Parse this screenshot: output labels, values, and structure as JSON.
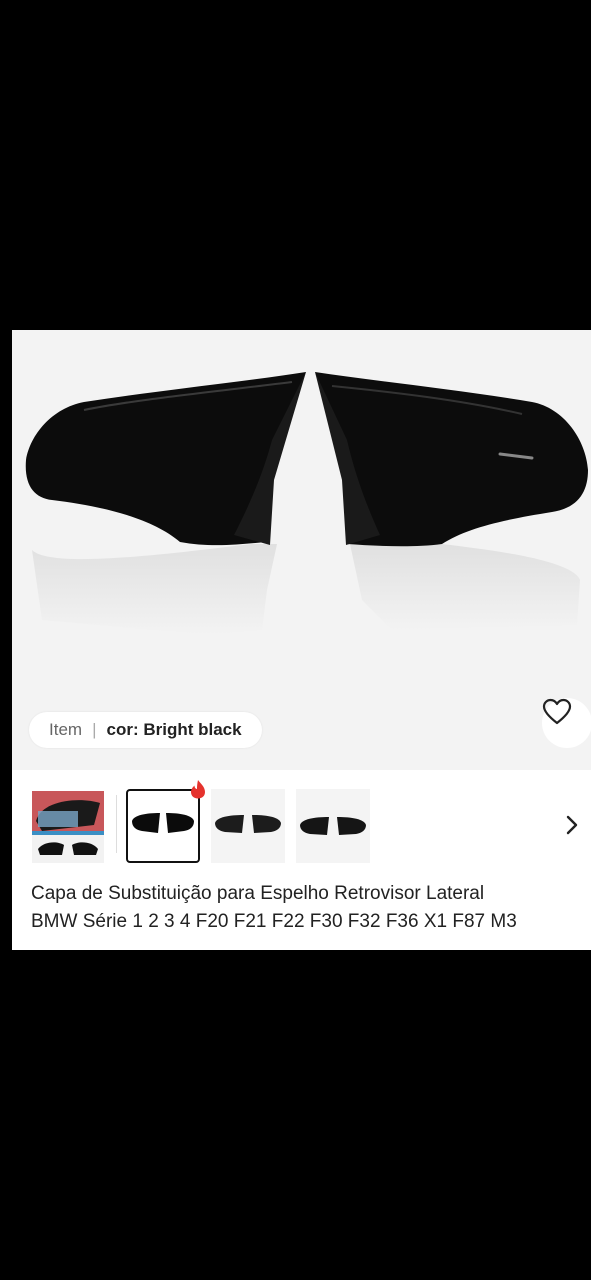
{
  "product": {
    "variant_chip": {
      "label": "Item",
      "separator": "|",
      "value": "cor: Bright black"
    },
    "title_line1": "Capa de Substituição para Espelho Retrovisor Lateral",
    "title_line2": "BMW Série 1 2 3 4 F20 F21 F22 F30 F32 F36 X1 F87 M3",
    "thumbnails": [
      {
        "name": "lifestyle-photo",
        "selected": false
      },
      {
        "name": "bright-black-pair",
        "selected": true,
        "badge_icon": "fire-icon"
      },
      {
        "name": "matte-pair",
        "selected": false
      },
      {
        "name": "carbon-pair",
        "selected": false
      }
    ],
    "icons": {
      "wishlist": "heart-outline-icon",
      "hot_badge": "fire-icon",
      "next": "chevron-right-icon"
    },
    "colors": {
      "badge": "#e5322d",
      "selected_border": "#111111"
    }
  }
}
